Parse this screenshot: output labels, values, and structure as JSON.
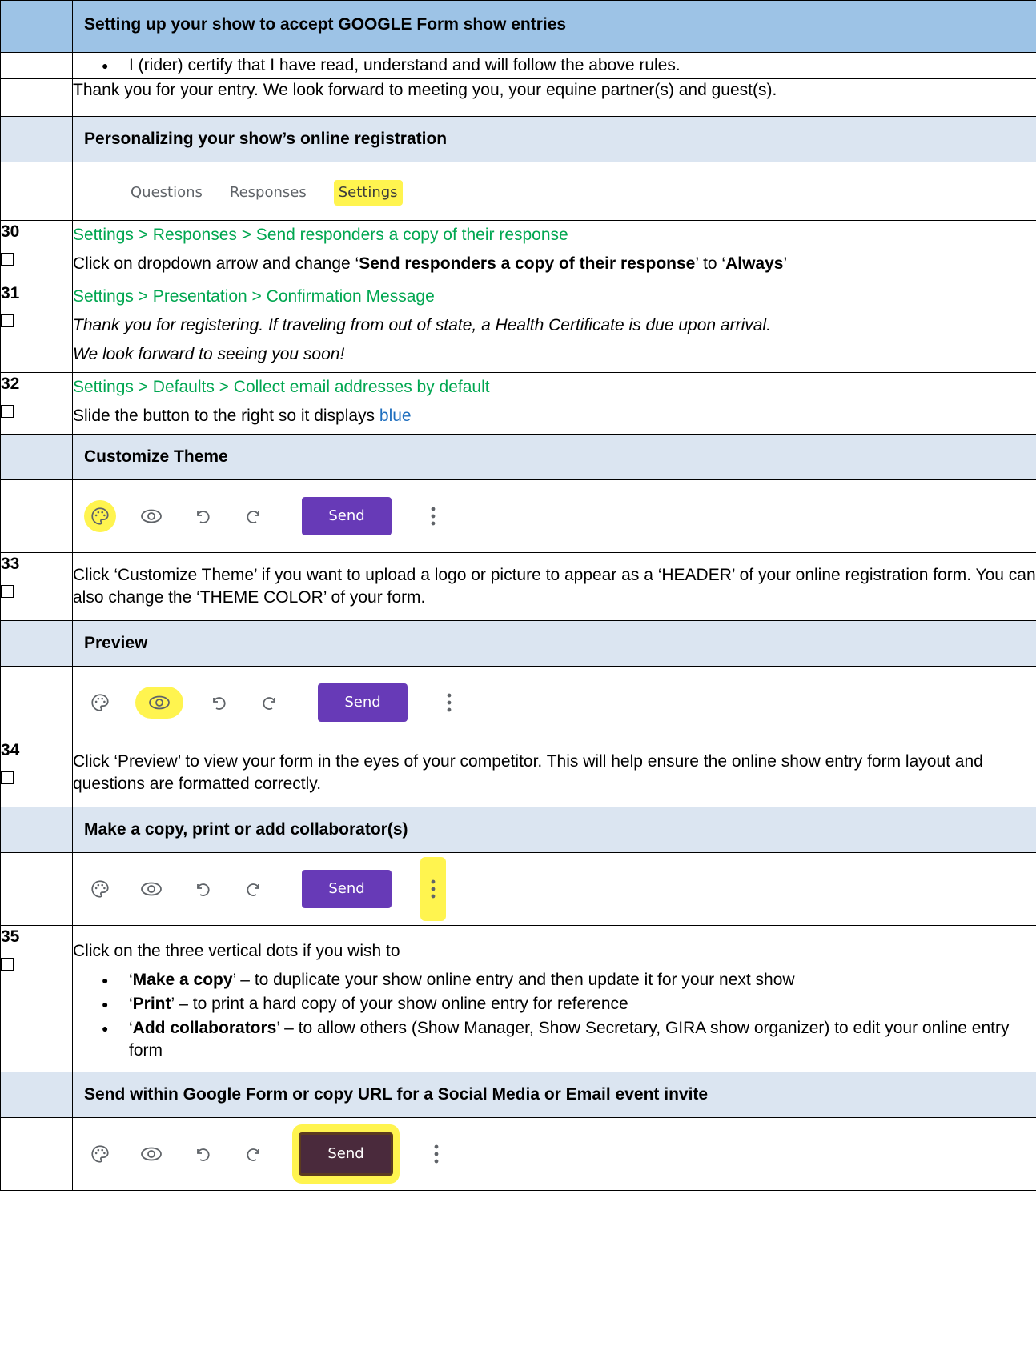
{
  "sections": {
    "setup": "Setting up your show to accept GOOGLE Form show entries",
    "personalize": "Personalizing your show’s online registration",
    "theme": "Customize Theme",
    "preview": "Preview",
    "copy": "Make a copy, print or add collaborator(s)",
    "send": "Send within Google Form or copy URL for a Social Media or Email event invite"
  },
  "certify": "I (rider) certify that I have read, understand and will follow the above rules.",
  "thanks": "Thank you for your entry.  We look forward to meeting you, your equine partner(s) and guest(s).",
  "tabs": {
    "questions": "Questions",
    "responses": "Responses",
    "settings": "Settings"
  },
  "toolbar": {
    "send_label": "Send"
  },
  "steps": {
    "s30": {
      "num": "30",
      "path": "Settings > Responses > Send responders a copy of their response",
      "pre": "Click on dropdown arrow and change ‘",
      "b1": "Send responders a copy of their response",
      "mid": "’ to ‘",
      "b2": "Always",
      "post": "’"
    },
    "s31": {
      "num": "31",
      "path": "Settings > Presentation > Confirmation Message",
      "line1": "Thank you for registering.  If traveling from out of state, a Health Certificate is due upon arrival.",
      "line2": "We look forward to seeing you soon!"
    },
    "s32": {
      "num": "32",
      "path": "Settings > Defaults > Collect email addresses by default",
      "text": "Slide the button to the right so it displays ",
      "blue": "blue"
    },
    "s33": {
      "num": "33",
      "text": "Click ‘Customize Theme’ if you want to upload a logo or picture to appear as a ‘HEADER’ of your online registration form. You can also change the ‘THEME COLOR’ of your form."
    },
    "s34": {
      "num": "34",
      "text": "Click ‘Preview’ to view your form in the eyes of your competitor.  This will help ensure the online show entry form layout and questions are formatted correctly."
    },
    "s35": {
      "num": "35",
      "intro": "Click on the three vertical dots if you wish to",
      "items": [
        {
          "open": "‘",
          "bold": "Make a copy",
          "rest": "’ – to duplicate your show online entry and then update it for your next show"
        },
        {
          "open": "‘",
          "bold": "Print",
          "rest": "’ – to print a hard copy of your show online entry for reference"
        },
        {
          "open": "‘",
          "bold": "Add collaborators",
          "rest": "’ – to allow others (Show Manager, Show Secretary, GIRA show organizer) to edit your online entry form"
        }
      ]
    }
  },
  "colors": {
    "header_top": "#9dc3e6",
    "header": "#dbe5f1",
    "green": "#00a650",
    "purple": "#673ab7",
    "highlight": "#fff44f"
  }
}
